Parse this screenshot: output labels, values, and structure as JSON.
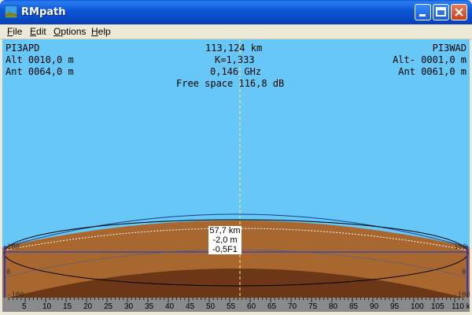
{
  "window": {
    "title": "RMpath"
  },
  "menu": [
    "File",
    "Edit",
    "Options",
    "Help"
  ],
  "left_station": {
    "name": "PI3APD",
    "alt": "Alt 0010,0 m",
    "ant": "Ant 0064,0 m"
  },
  "right_station": {
    "name": "PI3WAD",
    "alt": "Alt- 0001,0 m",
    "ant": "Ant 0061,0 m"
  },
  "center_info": {
    "distance": "113,124 km",
    "k_factor": "K=1,333",
    "frequency": "0,146 GHz",
    "free_space": "Free space 116,8 dB"
  },
  "cursor_readout": {
    "distance": "57,7 km",
    "height": "-2,0 m",
    "fresnel": "-0,5F1"
  },
  "axis": {
    "ticks": [
      "5",
      "10",
      "15",
      "20",
      "25",
      "30",
      "35",
      "40",
      "45",
      "50",
      "55",
      "60",
      "65",
      "70",
      "75",
      "80",
      "85",
      "90",
      "95",
      "100",
      "105",
      "110 km"
    ],
    "left_height_labels": [
      "100",
      "0",
      "-100"
    ],
    "right_height_labels": [
      "100",
      "0",
      "-100"
    ]
  },
  "colors": {
    "sky": "#67c8f8",
    "terrain_light": "#a8672e",
    "terrain_dark": "#6b3716",
    "axis_bg": "#8a8a8a",
    "cursor": "#ffe86b"
  }
}
